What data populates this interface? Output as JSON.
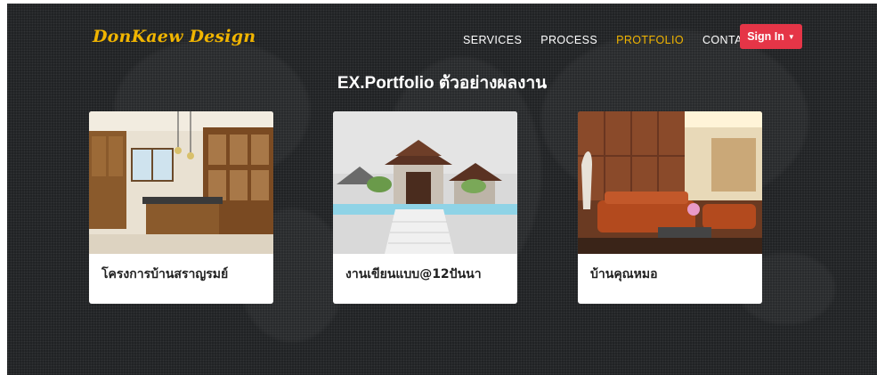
{
  "brand": {
    "name": "DonKaew Design",
    "color": "#f1b500"
  },
  "nav": {
    "links": [
      {
        "label": "SERVICES",
        "active": false
      },
      {
        "label": "PROCESS",
        "active": false
      },
      {
        "label": "PROTFOLIO",
        "active": true
      },
      {
        "label": "CONTACT",
        "active": false
      }
    ],
    "signin_label": "Sign In",
    "signin_color": "#e53547"
  },
  "section": {
    "title": "EX.Portfolio ตัวอย่างผลงาน"
  },
  "cards": [
    {
      "title": "โครงการบ้านสราญรมย์",
      "image": "kitchen-interior-photo"
    },
    {
      "title": "งานเขียนแบบ@12ปันนา",
      "image": "thai-pavilion-render"
    },
    {
      "title": "บ้านคุณหมอ",
      "image": "living-room-photo"
    }
  ]
}
